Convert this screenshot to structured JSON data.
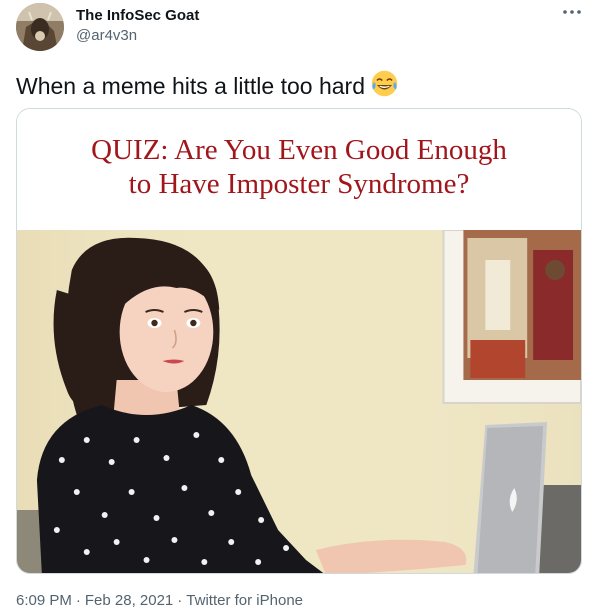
{
  "author": {
    "name": "The InfoSec Goat",
    "handle": "@ar4v3n"
  },
  "more_icon": "more-horizontal-icon",
  "tweet": {
    "text": "When a meme hits a little too hard",
    "emoji": "face-with-tears-of-joy"
  },
  "media": {
    "quiz_line1": "QUIZ: Are You Even Good Enough",
    "quiz_line2": "to Have Imposter Syndrome?",
    "quiz_color": "#a0161b"
  },
  "meta": {
    "time": "6:09 PM",
    "date": "Feb 28, 2021",
    "source": "Twitter for iPhone",
    "separator": "·"
  }
}
